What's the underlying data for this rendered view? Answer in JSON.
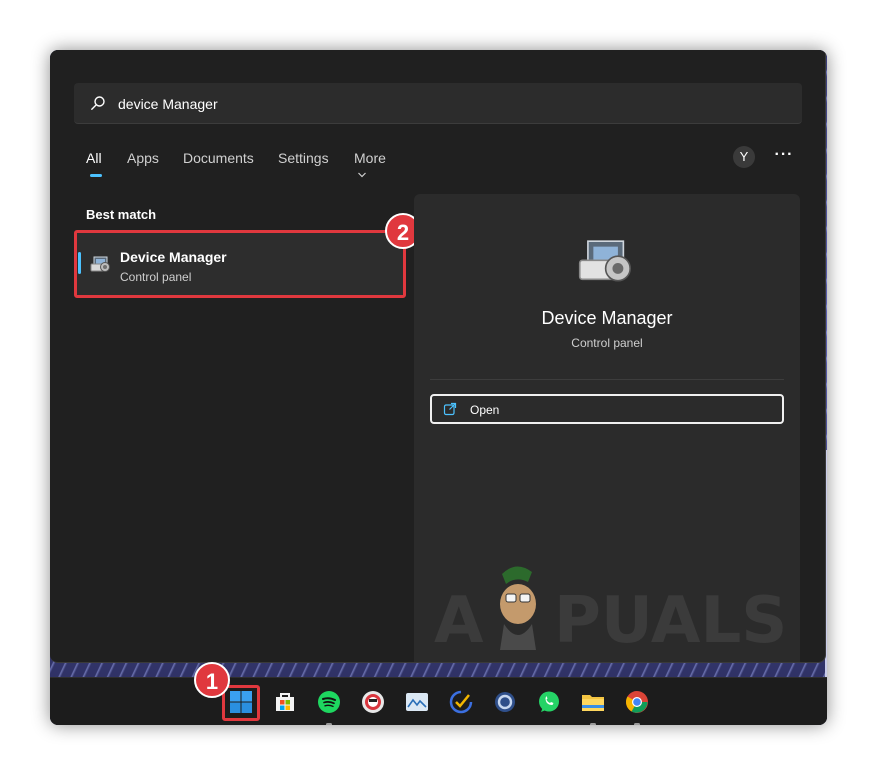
{
  "search": {
    "value": "device Manager"
  },
  "tabs": [
    {
      "label": "All",
      "active": true
    },
    {
      "label": "Apps"
    },
    {
      "label": "Documents"
    },
    {
      "label": "Settings"
    },
    {
      "label": "More"
    }
  ],
  "header": {
    "avatar_initial": "Y",
    "more_options": "···"
  },
  "results": {
    "section_label": "Best match",
    "best": {
      "title": "Device Manager",
      "subtitle": "Control panel",
      "icon": "device-manager-icon"
    }
  },
  "preview": {
    "title": "Device Manager",
    "subtitle": "Control panel",
    "icon": "device-manager-icon",
    "actions": [
      {
        "label": "Open",
        "icon": "open-external-icon"
      }
    ]
  },
  "annotations": {
    "badge_1": "1",
    "badge_2": "2",
    "color": "#e0383e"
  },
  "watermark": {
    "text": "APPUALS"
  },
  "taskbar": {
    "apps": [
      {
        "name": "start",
        "icon": "windows-start-icon"
      },
      {
        "name": "microsoft-store",
        "icon": "store-icon"
      },
      {
        "name": "spotify",
        "icon": "spotify-icon"
      },
      {
        "name": "app",
        "icon": "circle-app-icon"
      },
      {
        "name": "photos",
        "icon": "photos-icon"
      },
      {
        "name": "tasks",
        "icon": "check-icon"
      },
      {
        "name": "app",
        "icon": "ring-app-icon"
      },
      {
        "name": "whatsapp",
        "icon": "whatsapp-icon"
      },
      {
        "name": "file-explorer",
        "icon": "folder-icon"
      },
      {
        "name": "chrome",
        "icon": "chrome-icon"
      }
    ]
  },
  "colors": {
    "accent": "#4cc2ff",
    "panel": "#202020",
    "highlight": "#e0383e"
  }
}
